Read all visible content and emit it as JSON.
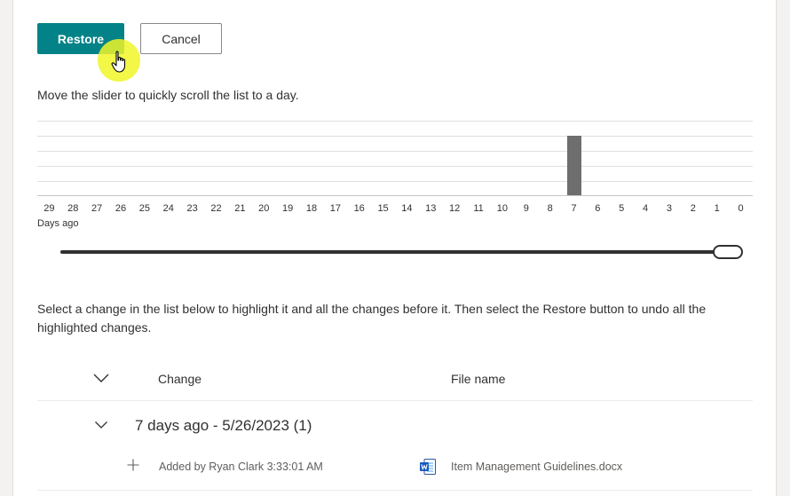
{
  "actions": {
    "restore_label": "Restore",
    "cancel_label": "Cancel"
  },
  "instruction": "Move the slider to quickly scroll the list to a day.",
  "chart_data": {
    "type": "bar",
    "x_ticks": [
      "29",
      "28",
      "27",
      "26",
      "25",
      "24",
      "23",
      "22",
      "21",
      "20",
      "19",
      "18",
      "17",
      "16",
      "15",
      "14",
      "13",
      "12",
      "11",
      "10",
      "9",
      "8",
      "7",
      "6",
      "5",
      "4",
      "3",
      "2",
      "1",
      "0"
    ],
    "categories": [
      "29",
      "28",
      "27",
      "26",
      "25",
      "24",
      "23",
      "22",
      "21",
      "20",
      "19",
      "18",
      "17",
      "16",
      "15",
      "14",
      "13",
      "12",
      "11",
      "10",
      "9",
      "8",
      "7",
      "6",
      "5",
      "4",
      "3",
      "2",
      "1",
      "0"
    ],
    "values": [
      0,
      0,
      0,
      0,
      0,
      0,
      0,
      0,
      0,
      0,
      0,
      0,
      0,
      0,
      0,
      0,
      0,
      0,
      0,
      0,
      0,
      0,
      1,
      0,
      0,
      0,
      0,
      0,
      0,
      0
    ],
    "ylim": [
      0,
      1.25
    ],
    "grid": true,
    "xlabel": "Days ago",
    "bar_color": "#6e6e6e"
  },
  "slider": {
    "value_days_ago": 0
  },
  "description": "Select a change in the list below to highlight it and all the changes before it. Then select the Restore button to undo all the highlighted changes.",
  "list": {
    "columns": {
      "change": "Change",
      "file_name": "File name"
    },
    "groups": [
      {
        "title": "7 days ago - 5/26/2023 (1)",
        "items": [
          {
            "change": "Added by Ryan Clark 3:33:01 AM",
            "file_name": "Item Management Guidelines.docx",
            "file_icon": "word-doc-icon"
          }
        ]
      }
    ]
  },
  "colors": {
    "accent": "#038387",
    "bar": "#6e6e6e",
    "cursor_highlight": "#f0f628"
  }
}
